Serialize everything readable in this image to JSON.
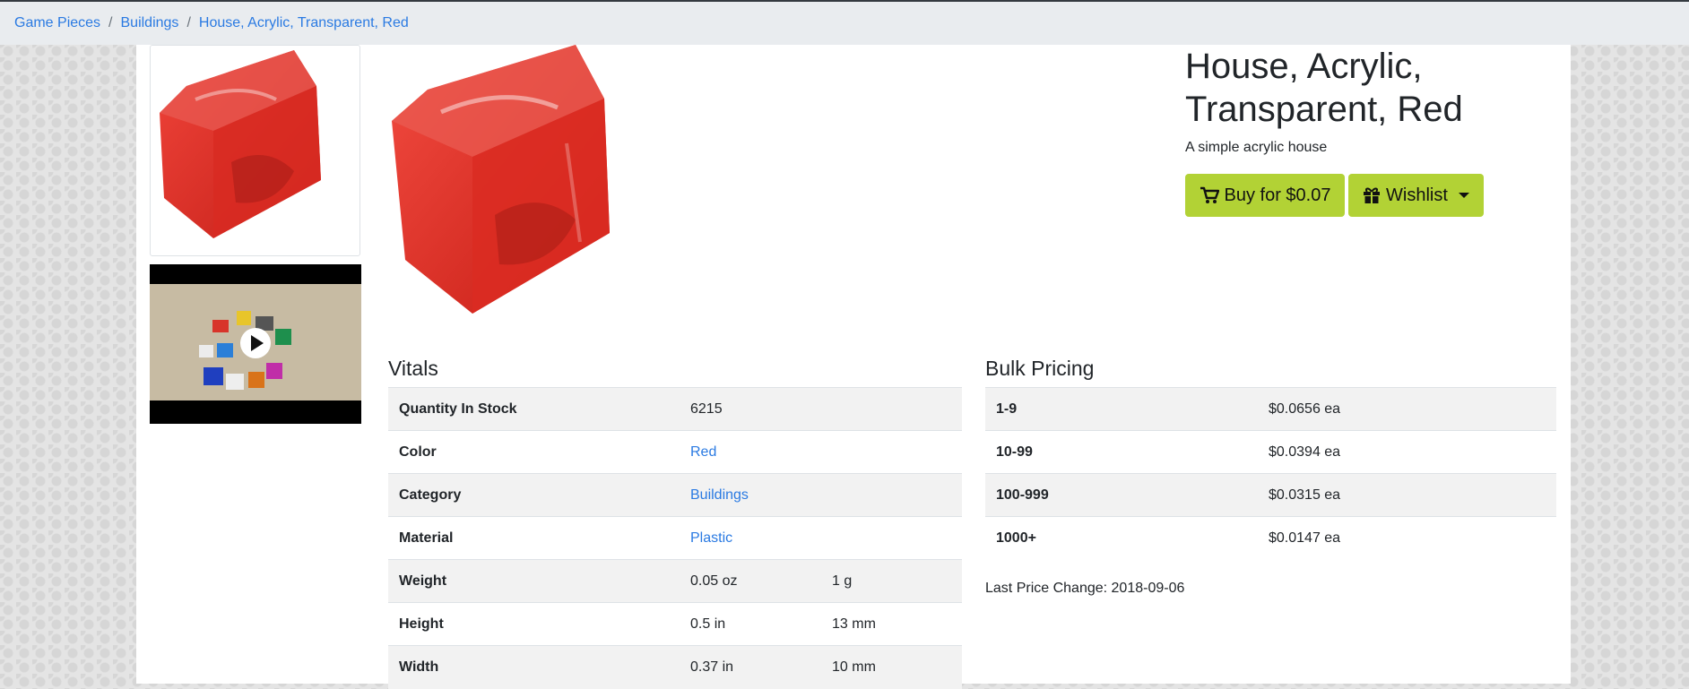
{
  "breadcrumb": [
    "Game Pieces",
    "Buildings",
    "House, Acrylic, Transparent, Red"
  ],
  "product": {
    "title": "House, Acrylic, Transparent, Red",
    "subtitle": "A simple acrylic house",
    "buy_label": "Buy for $0.07",
    "wishlist_label": "Wishlist",
    "color_hex": "#e02a1f"
  },
  "vitals": {
    "heading": "Vitals",
    "rows": [
      {
        "label": "Quantity In Stock",
        "value": "6215",
        "value2": ""
      },
      {
        "label": "Color",
        "value": "Red",
        "value2": ""
      },
      {
        "label": "Category",
        "value": "Buildings",
        "value2": ""
      },
      {
        "label": "Material",
        "value": "Plastic",
        "value2": ""
      },
      {
        "label": "Weight",
        "value": "0.05 oz",
        "value2": "1 g"
      },
      {
        "label": "Height",
        "value": "0.5 in",
        "value2": "13 mm"
      },
      {
        "label": "Width",
        "value": "0.37 in",
        "value2": "10 mm"
      }
    ]
  },
  "bulk": {
    "heading": "Bulk Pricing",
    "rows": [
      {
        "qty": "1-9",
        "price": "$0.0656 ea"
      },
      {
        "qty": "10-99",
        "price": "$0.0394 ea"
      },
      {
        "qty": "100-999",
        "price": "$0.0315 ea"
      },
      {
        "qty": "1000+",
        "price": "$0.0147 ea"
      }
    ],
    "last_change": "Last Price Change: 2018-09-06"
  },
  "icons": {
    "cart": "cart-icon",
    "gift": "gift-icon",
    "play": "play-icon"
  },
  "colors": {
    "accent": "#b2d235",
    "link": "#2a7ae2",
    "breadcrumb_bg": "#e9ecef"
  }
}
